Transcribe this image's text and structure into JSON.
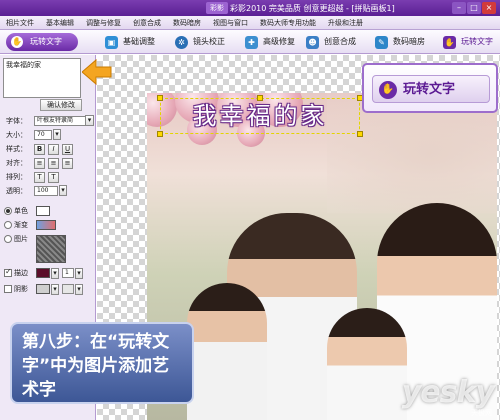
{
  "window": {
    "title": "彩影2010  完美品质  创意更超越 - [拼贴画板1]",
    "logo": "彩影"
  },
  "menu": [
    "相片文件",
    "基本编辑",
    "调整与修复",
    "创意合成",
    "数码暗房",
    "视图与窗口",
    "数码大师专用功能",
    "升级和注册"
  ],
  "toolbar": {
    "main_button": "玩转文字",
    "buttons": [
      {
        "label": "基础调整",
        "icon": "adjust-icon"
      },
      {
        "label": "镜头校正",
        "icon": "lens-icon"
      },
      {
        "label": "高级修复",
        "icon": "repair-icon"
      },
      {
        "label": "创意合成",
        "icon": "composite-icon"
      },
      {
        "label": "数码暗房",
        "icon": "darkroom-icon"
      },
      {
        "label": "玩转文字",
        "icon": "text-icon"
      }
    ]
  },
  "panel": {
    "text_value": "我幸福的家",
    "confirm_label": "确认修改",
    "font_label": "字体：",
    "font_value": "叶根友特隶简",
    "size_label": "大小：",
    "size_value": "70",
    "style_label": "样式：",
    "style_bold": "B",
    "style_italic": "I",
    "style_underline": "U",
    "align_label": "对齐：",
    "direction_label": "排列：",
    "opacity_label": "透明：",
    "opacity_value": "100",
    "fill_solid": "单色",
    "fill_gradient": "渐变",
    "fill_image": "图片",
    "stroke_label": "描边",
    "stroke_width": "1",
    "shadow_label": "阴影"
  },
  "canvas": {
    "art_text": "我幸福的家"
  },
  "callout": {
    "label": "玩转文字"
  },
  "step": {
    "text": "第八步：在“玩转文字”中为图片添加艺术字"
  },
  "watermark": {
    "main": "yesky",
    "sub": "天极网"
  },
  "colors": {
    "accent": "#6a2aa6",
    "stroke_color": "#5a0d2a"
  }
}
